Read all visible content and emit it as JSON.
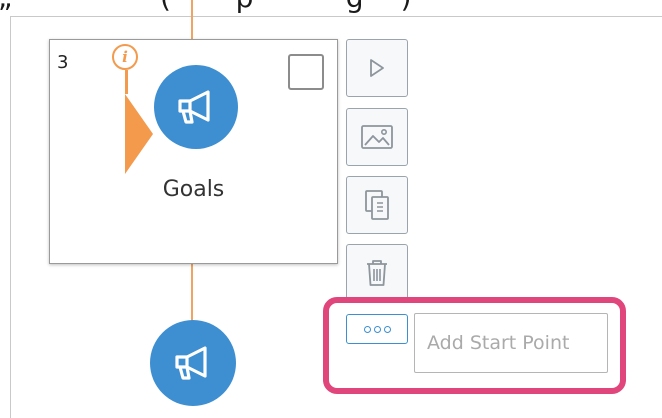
{
  "header": {
    "partial_text": "„                (       p          g    )"
  },
  "step": {
    "number": "3",
    "label": "Goals",
    "icon": "megaphone-icon",
    "info_symbol": "i",
    "accent_color": "#f39a4c",
    "icon_color": "#3d8fd1"
  },
  "next_step": {
    "icon": "megaphone-icon"
  },
  "side_toolbar": {
    "items": [
      {
        "name": "play-icon"
      },
      {
        "name": "image-icon"
      },
      {
        "name": "copy-icon"
      },
      {
        "name": "trash-icon"
      },
      {
        "name": "more-icon"
      }
    ]
  },
  "start_point": {
    "placeholder": "Add Start Point",
    "value": ""
  },
  "highlight_color": "#e0457b"
}
